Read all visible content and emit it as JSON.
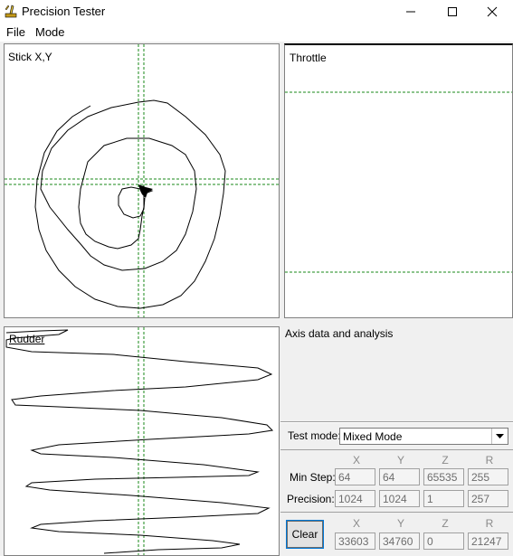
{
  "window": {
    "title": "Precision Tester",
    "app_icon": "joystick-icon",
    "minimize_icon": "minimize-icon",
    "maximize_icon": "maximize-icon",
    "close_icon": "close-icon"
  },
  "menu": [
    "File",
    "Mode"
  ],
  "panels": {
    "stick_label": "Stick X,Y",
    "throttle_label": "Throttle",
    "rudder_label": "Rudder",
    "analysis_label": "Axis data and analysis"
  },
  "test_mode": {
    "label": "Test mode:",
    "selected": "Mixed Mode"
  },
  "axes": [
    "X",
    "Y",
    "Z",
    "R"
  ],
  "stats": {
    "min_step_label": "Min Step:",
    "min_step": [
      "64",
      "64",
      "65535",
      "255"
    ],
    "precision_label": "Precision:",
    "precision": [
      "1024",
      "1024",
      "1",
      "257"
    ]
  },
  "clear": {
    "label": "Clear",
    "values": [
      "33603",
      "34760",
      "0",
      "21247"
    ]
  },
  "colors": {
    "guide": "#1a8a1a",
    "trace": "#000000"
  }
}
